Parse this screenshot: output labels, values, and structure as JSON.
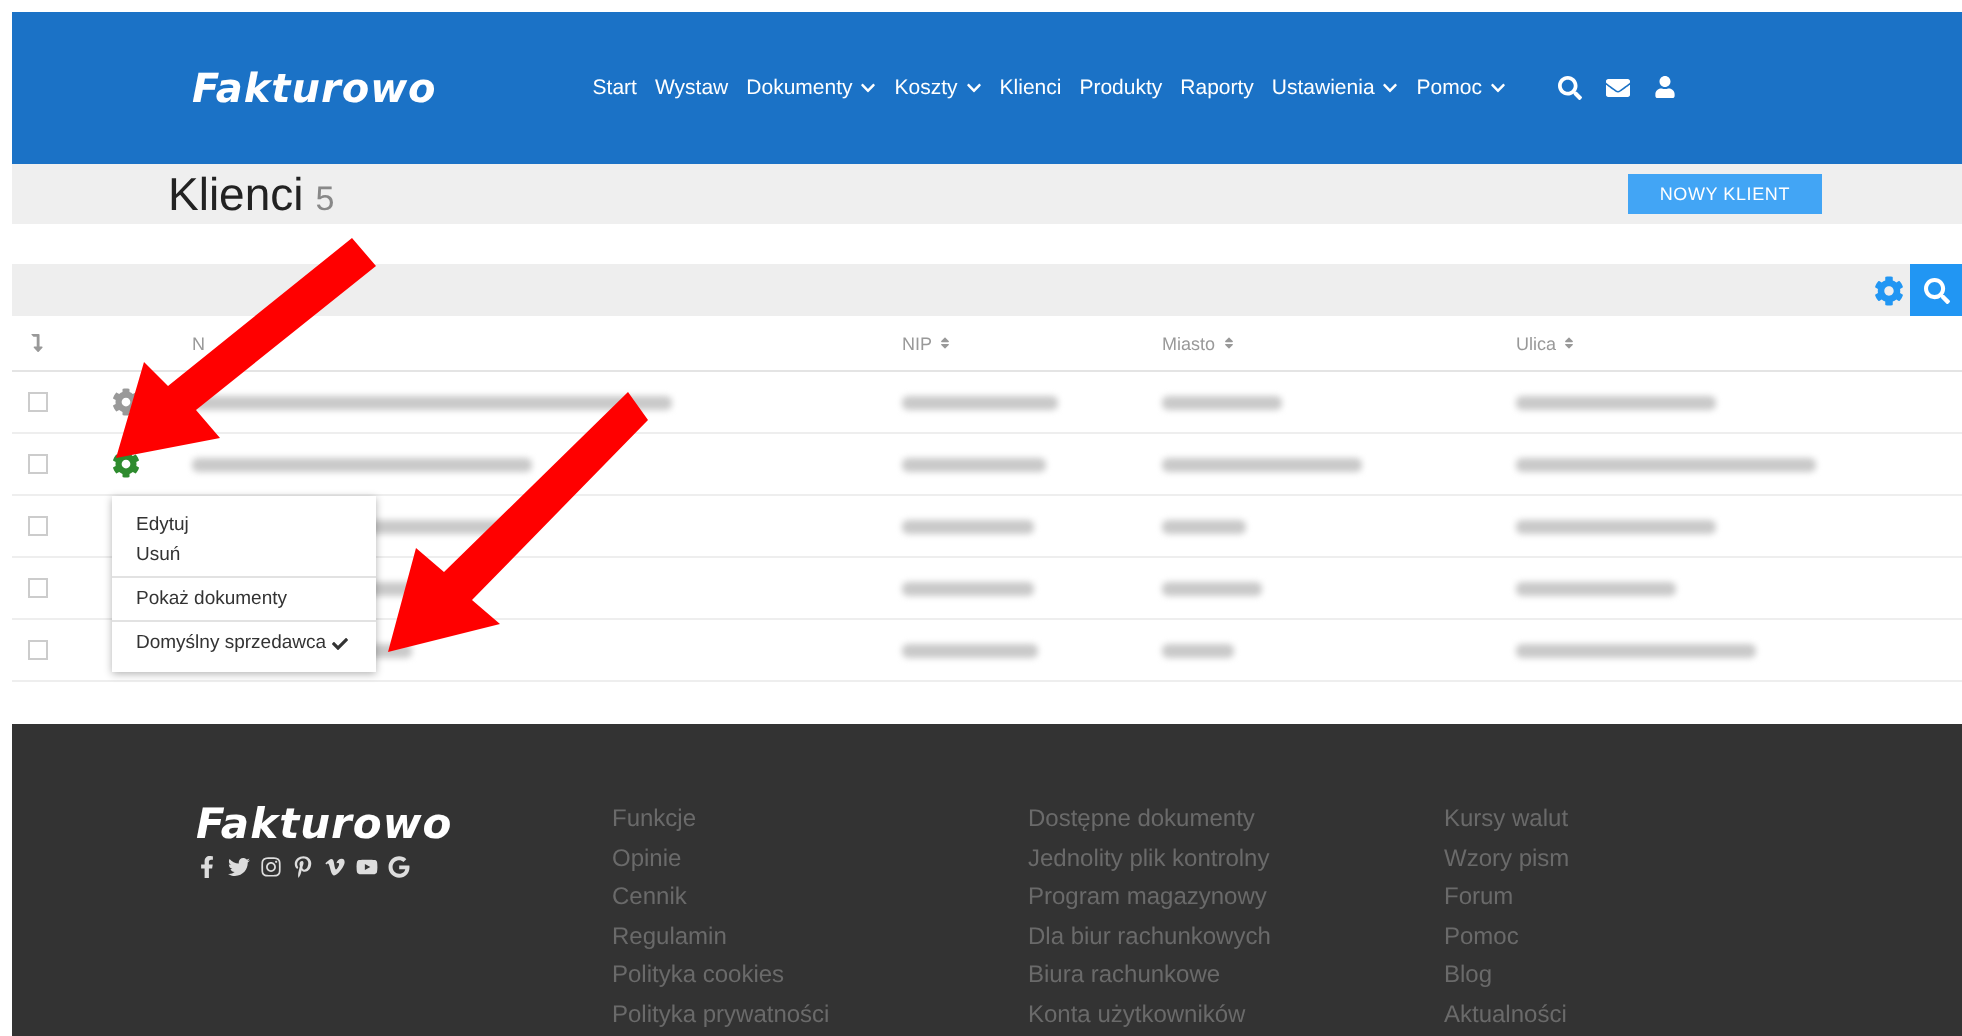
{
  "header": {
    "logo": "Fakturowo",
    "nav": [
      {
        "label": "Start",
        "dropdown": false
      },
      {
        "label": "Wystaw",
        "dropdown": false
      },
      {
        "label": "Dokumenty",
        "dropdown": true
      },
      {
        "label": "Koszty",
        "dropdown": true
      },
      {
        "label": "Klienci",
        "dropdown": false
      },
      {
        "label": "Produkty",
        "dropdown": false
      },
      {
        "label": "Raporty",
        "dropdown": false
      },
      {
        "label": "Ustawienia",
        "dropdown": true
      },
      {
        "label": "Pomoc",
        "dropdown": true
      }
    ]
  },
  "page": {
    "title": "Klienci",
    "count": "5",
    "new_button": "NOWY KLIENT"
  },
  "table": {
    "columns": [
      "N",
      "NIP",
      "Miasto",
      "Ulica"
    ],
    "rows": [
      {
        "checked": false,
        "gear_active": false
      },
      {
        "checked": false,
        "gear_active": true
      },
      {
        "checked": false
      },
      {
        "checked": false
      },
      {
        "checked": false
      }
    ]
  },
  "menu": {
    "groups": [
      [
        {
          "label": "Edytuj",
          "checked": false
        },
        {
          "label": "Usuń",
          "checked": false
        }
      ],
      [
        {
          "label": "Pokaż dokumenty",
          "checked": false
        }
      ],
      [
        {
          "label": "Domyślny sprzedawca",
          "checked": true
        }
      ]
    ]
  },
  "footer": {
    "logo": "Fakturowo",
    "columns": [
      [
        "Funkcje",
        "Opinie",
        "Cennik",
        "Regulamin",
        "Polityka cookies",
        "Polityka prywatności"
      ],
      [
        "Dostępne dokumenty",
        "Jednolity plik kontrolny",
        "Program magazynowy",
        "Dla biur rachunkowych",
        "Biura rachunkowe",
        "Konta użytkowników"
      ],
      [
        "Kursy walut",
        "Wzory pism",
        "Forum",
        "Pomoc",
        "Blog",
        "Aktualności"
      ]
    ]
  }
}
